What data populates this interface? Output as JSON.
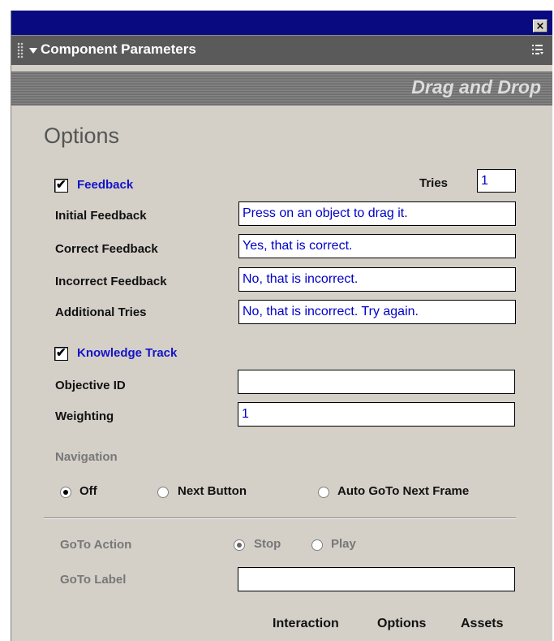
{
  "window": {
    "close_glyph": "×"
  },
  "panel": {
    "title": "Component Parameters",
    "menu_icon": "panel-menu-icon"
  },
  "banner": {
    "title": "Drag and Drop"
  },
  "options": {
    "heading": "Options",
    "feedback": {
      "checked": true,
      "label": "Feedback",
      "tries_label": "Tries",
      "tries_value": "1",
      "fields": [
        {
          "label": "Initial Feedback",
          "value": "Press on an object to drag it."
        },
        {
          "label": "Correct Feedback",
          "value": "Yes, that is correct."
        },
        {
          "label": "Incorrect Feedback",
          "value": "No, that is incorrect."
        },
        {
          "label": "Additional Tries",
          "value": "No, that is incorrect. Try again."
        }
      ]
    },
    "knowledge_track": {
      "checked": true,
      "label": "Knowledge Track",
      "objective_label": "Objective ID",
      "objective_value": "",
      "weighting_label": "Weighting",
      "weighting_value": "1"
    },
    "navigation": {
      "heading": "Navigation",
      "options": [
        {
          "label": "Off",
          "selected": true
        },
        {
          "label": "Next Button",
          "selected": false
        },
        {
          "label": "Auto GoTo Next Frame",
          "selected": false
        }
      ]
    },
    "goto": {
      "action_label": "GoTo Action",
      "action_options": [
        {
          "label": "Stop",
          "selected": true
        },
        {
          "label": "Play",
          "selected": false
        }
      ],
      "label_label": "GoTo Label",
      "label_value": ""
    }
  },
  "tabs": [
    {
      "label": "Interaction",
      "active": false
    },
    {
      "label": "Options",
      "active": true
    },
    {
      "label": "Assets",
      "active": false
    }
  ],
  "colors": {
    "titlebar": "#0a0a80",
    "panel_bg": "#d4d0c8",
    "accent_blue": "#1414c8"
  }
}
